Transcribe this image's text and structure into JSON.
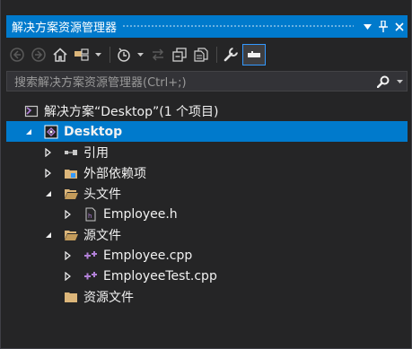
{
  "window": {
    "title": "解决方案资源管理器",
    "pin_glyph": "▾",
    "autohide_glyph": "⊥",
    "close_glyph": "✕"
  },
  "toolbar": {
    "buttons": [
      {
        "name": "back-icon"
      },
      {
        "name": "forward-icon"
      },
      {
        "name": "home-icon"
      },
      {
        "name": "switch-views-icon"
      },
      {
        "name": "history-icon"
      },
      {
        "name": "sync-icon"
      },
      {
        "name": "collapse-all-icon"
      },
      {
        "name": "show-all-files-icon"
      },
      {
        "name": "properties-icon"
      },
      {
        "name": "preview-icon"
      }
    ]
  },
  "search": {
    "placeholder": "搜索解决方案资源管理器(Ctrl+;)"
  },
  "tree": {
    "solution": "解决方案“Desktop”(1 个项目)",
    "project": "Desktop",
    "references": "引用",
    "external_deps": "外部依赖项",
    "header_files": "头文件",
    "employee_h": "Employee.h",
    "source_files": "源文件",
    "employee_cpp": "Employee.cpp",
    "employee_test_cpp": "EmployeeTest.cpp",
    "resource_files": "资源文件"
  },
  "colors": {
    "accent": "#007acc",
    "background": "#252526",
    "folder": "#dcb67a",
    "cpp_icon": "#b180d7"
  }
}
